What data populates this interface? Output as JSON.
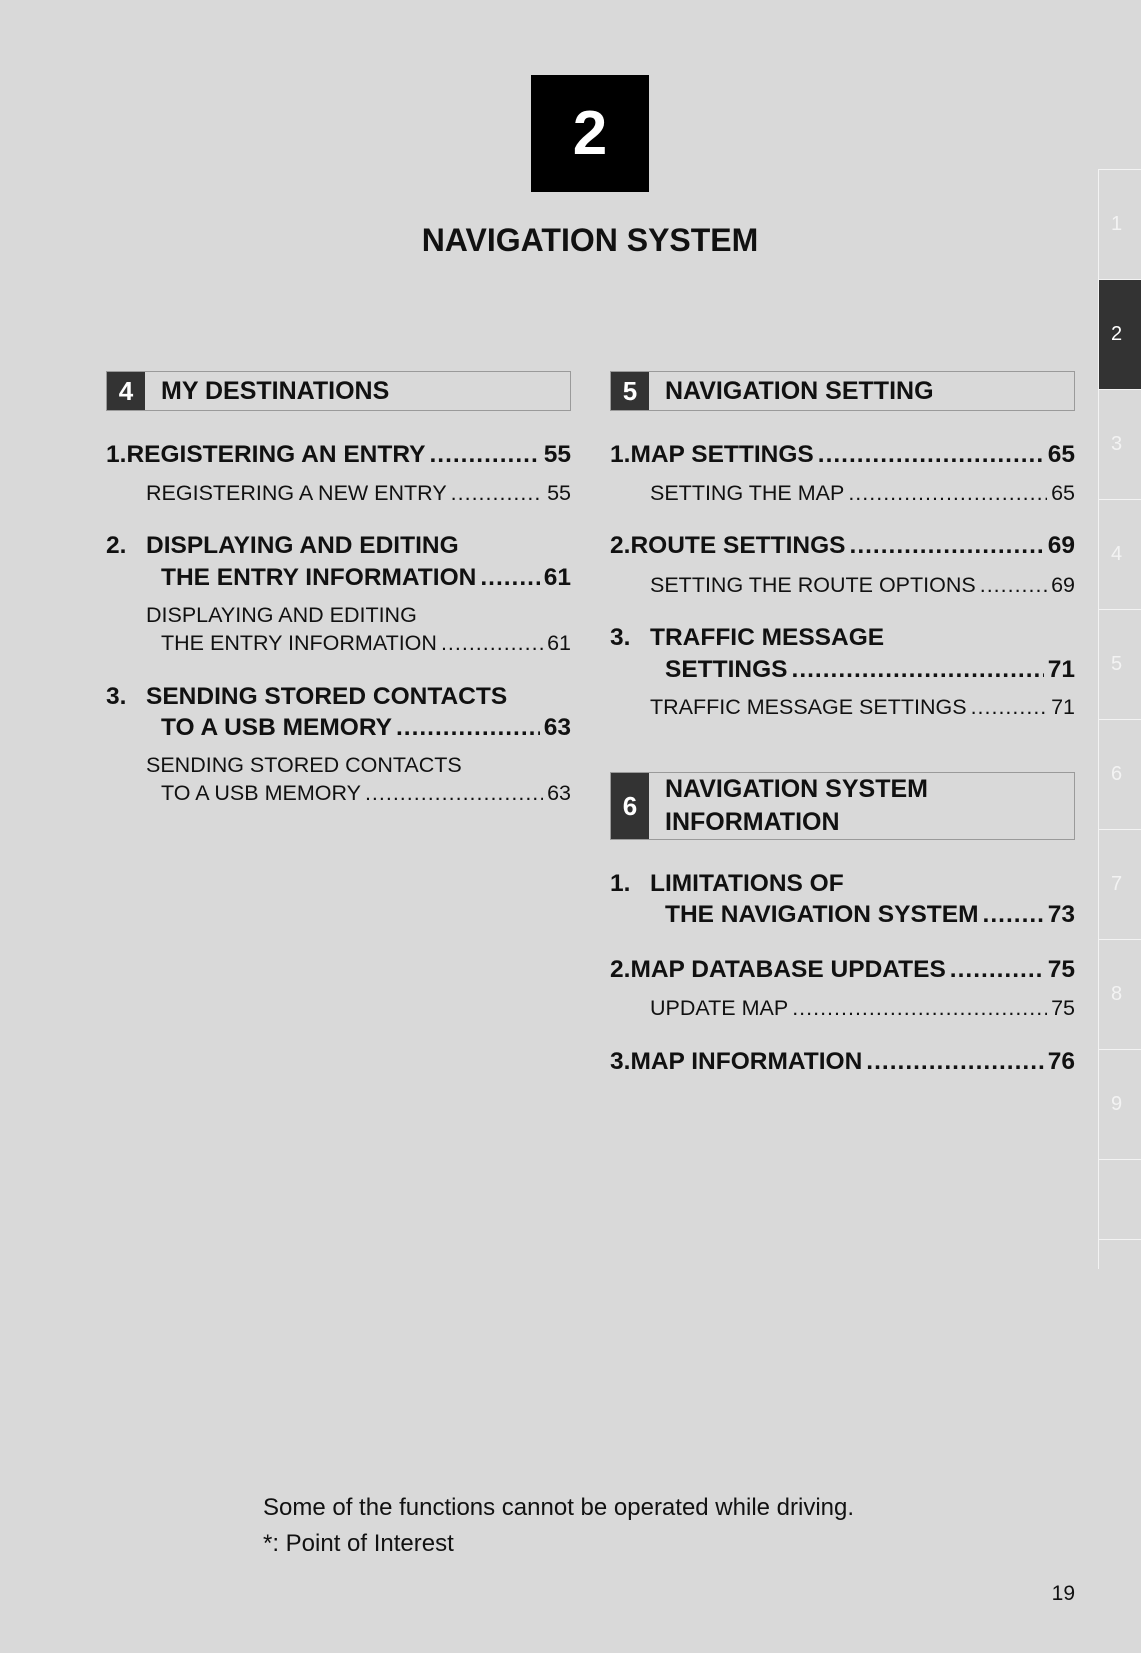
{
  "chapter": {
    "number": "2",
    "title": "NAVIGATION SYSTEM"
  },
  "sections": [
    {
      "number": "4",
      "title": "MY DESTINATIONS"
    },
    {
      "number": "5",
      "title": "NAVIGATION SETTING"
    },
    {
      "number": "6",
      "title_line1": "NAVIGATION SYSTEM",
      "title_line2": "INFORMATION"
    }
  ],
  "left": {
    "e1": {
      "idx": "1.",
      "text": "REGISTERING AN ENTRY",
      "page": "55"
    },
    "s1": {
      "text": "REGISTERING A NEW ENTRY",
      "page": "55"
    },
    "e2": {
      "idx": "2.",
      "line1": "DISPLAYING AND EDITING",
      "line2": "THE ENTRY INFORMATION",
      "page": "61"
    },
    "s2": {
      "line1": "DISPLAYING AND EDITING",
      "line2": "THE ENTRY INFORMATION",
      "page": "61"
    },
    "e3": {
      "idx": "3.",
      "line1": "SENDING STORED CONTACTS",
      "line2": "TO A USB MEMORY",
      "page": "63"
    },
    "s3": {
      "line1": "SENDING STORED CONTACTS",
      "line2": "TO A USB MEMORY",
      "page": "63"
    }
  },
  "right5": {
    "e1": {
      "idx": "1.",
      "text": "MAP SETTINGS",
      "page": "65"
    },
    "s1": {
      "text": "SETTING THE MAP",
      "page": "65"
    },
    "e2": {
      "idx": "2.",
      "text": "ROUTE SETTINGS",
      "page": "69"
    },
    "s2": {
      "text": "SETTING THE ROUTE OPTIONS",
      "page": "69"
    },
    "e3": {
      "idx": "3.",
      "line1": "TRAFFIC MESSAGE",
      "line2": "SETTINGS",
      "page": "71"
    },
    "s3": {
      "text": "TRAFFIC MESSAGE SETTINGS",
      "page": "71"
    }
  },
  "right6": {
    "e1": {
      "idx": "1.",
      "line1": "LIMITATIONS OF",
      "line2": "THE NAVIGATION SYSTEM",
      "page": "73"
    },
    "e2": {
      "idx": "2.",
      "text": "MAP DATABASE UPDATES",
      "page": "75"
    },
    "s2": {
      "text": "UPDATE MAP",
      "page": "75"
    },
    "e3": {
      "idx": "3.",
      "text": "MAP INFORMATION",
      "page": "76"
    }
  },
  "side_tabs": [
    "1",
    "2",
    "3",
    "4",
    "5",
    "6",
    "7",
    "8",
    "9",
    ""
  ],
  "active_tab": "2",
  "footer": {
    "note1": "Some of the functions cannot be operated while driving.",
    "note2": "*: Point of Interest"
  },
  "page_number": "19",
  "colors": {
    "background": "#d9d9d9",
    "section_number_bg": "#333333",
    "chapter_box": "#000000"
  }
}
